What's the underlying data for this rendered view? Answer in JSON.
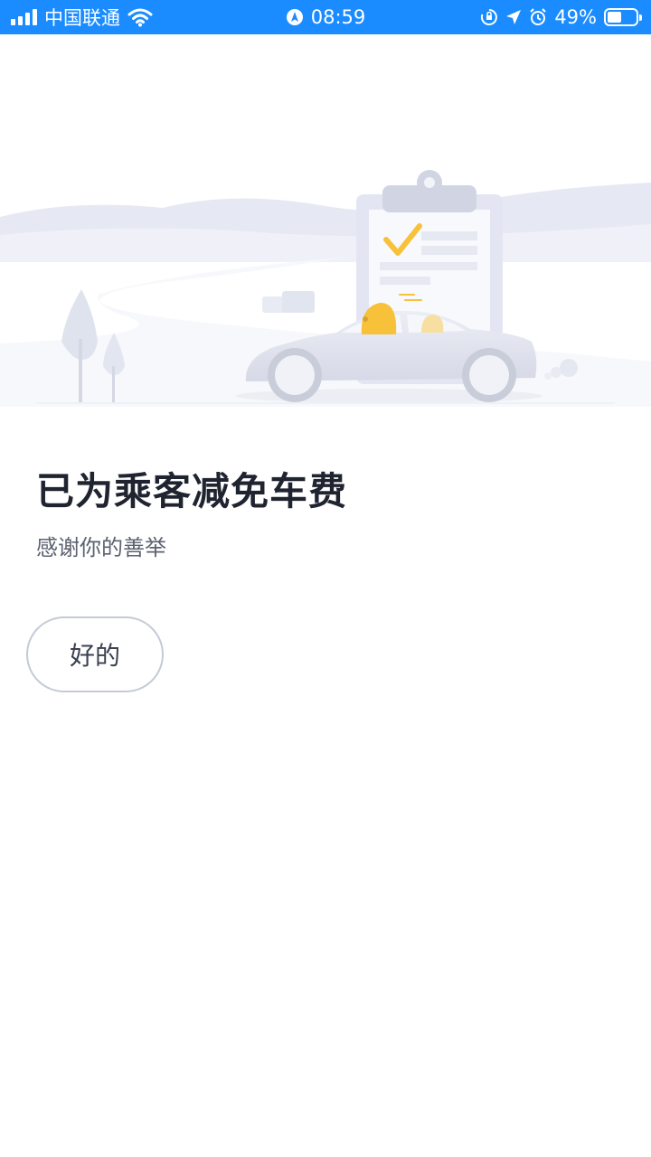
{
  "status_bar": {
    "carrier": "中国联通",
    "time": "08:59",
    "battery_percent": "49%",
    "battery_level": 0.49,
    "background_color": "#1a8cff"
  },
  "main": {
    "title": "已为乘客减免车费",
    "subtitle": "感谢你的善举",
    "ok_button_label": "好的"
  },
  "illustration": {
    "icons": [
      "clipboard-check-icon",
      "car-icon",
      "passenger-icon",
      "tree-icon"
    ],
    "accent_color": "#f7c23a"
  }
}
